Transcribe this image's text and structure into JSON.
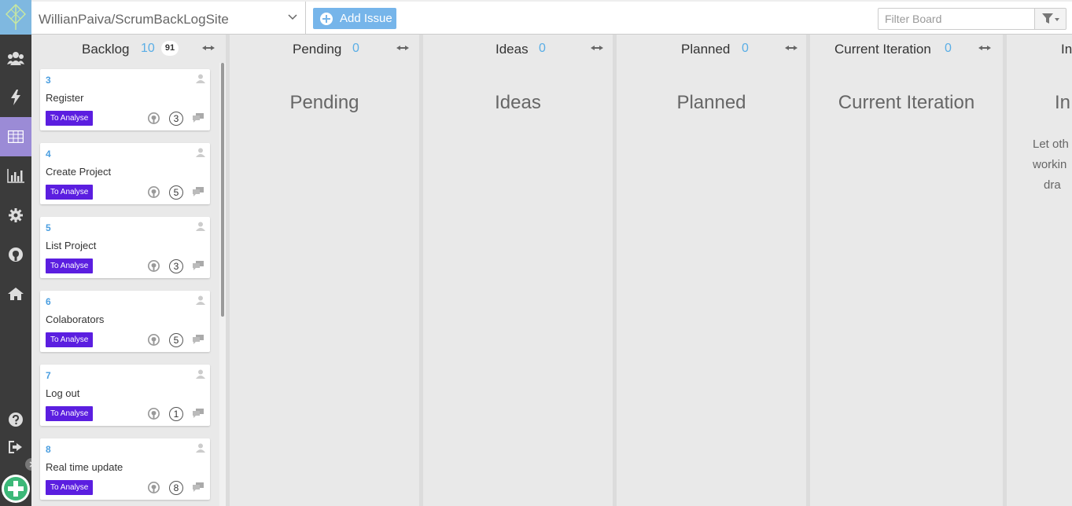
{
  "topbar": {
    "repo_name": "WillianPaiva/ScrumBackLogSite",
    "add_issue_label": "Add Issue",
    "filter_placeholder": "Filter Board"
  },
  "sidebar": {
    "items": [
      {
        "icon": "team-icon"
      },
      {
        "icon": "lightning-icon"
      },
      {
        "icon": "board-grid-icon",
        "active": true
      },
      {
        "icon": "chart-icon"
      },
      {
        "icon": "gear-icon"
      },
      {
        "icon": "github-icon"
      },
      {
        "icon": "home-icon"
      },
      {
        "icon": "help-icon"
      },
      {
        "icon": "logout-icon"
      }
    ]
  },
  "columns": [
    {
      "title": "Backlog",
      "count": "10",
      "total": "91",
      "empty_label": ""
    },
    {
      "title": "Pending",
      "count": "0",
      "empty_label": "Pending"
    },
    {
      "title": "Ideas",
      "count": "0",
      "empty_label": "Ideas"
    },
    {
      "title": "Planned",
      "count": "0",
      "empty_label": "Planned"
    },
    {
      "title": "Current Iteration",
      "count": "0",
      "empty_label": "Current Iteration"
    },
    {
      "title": "In",
      "empty_label": "In",
      "note_lines": [
        "Let oth",
        "workin",
        "dra"
      ]
    }
  ],
  "cards": [
    {
      "number": "3",
      "title": "Register",
      "label": "To Analyse",
      "points": "3"
    },
    {
      "number": "4",
      "title": "Create Project",
      "label": "To Analyse",
      "points": "5"
    },
    {
      "number": "5",
      "title": "List Project",
      "label": "To Analyse",
      "points": "3"
    },
    {
      "number": "6",
      "title": "Colaborators",
      "label": "To Analyse",
      "points": "5"
    },
    {
      "number": "7",
      "title": "Log out",
      "label": "To Analyse",
      "points": "1"
    },
    {
      "number": "8",
      "title": "Real time update",
      "label": "To Analyse",
      "points": "8"
    }
  ],
  "colors": {
    "accent": "#5aaee6",
    "label_bg": "#5b1ee0",
    "active_nav": "#9b8bd6",
    "rail_bg": "#3b3b3b"
  }
}
